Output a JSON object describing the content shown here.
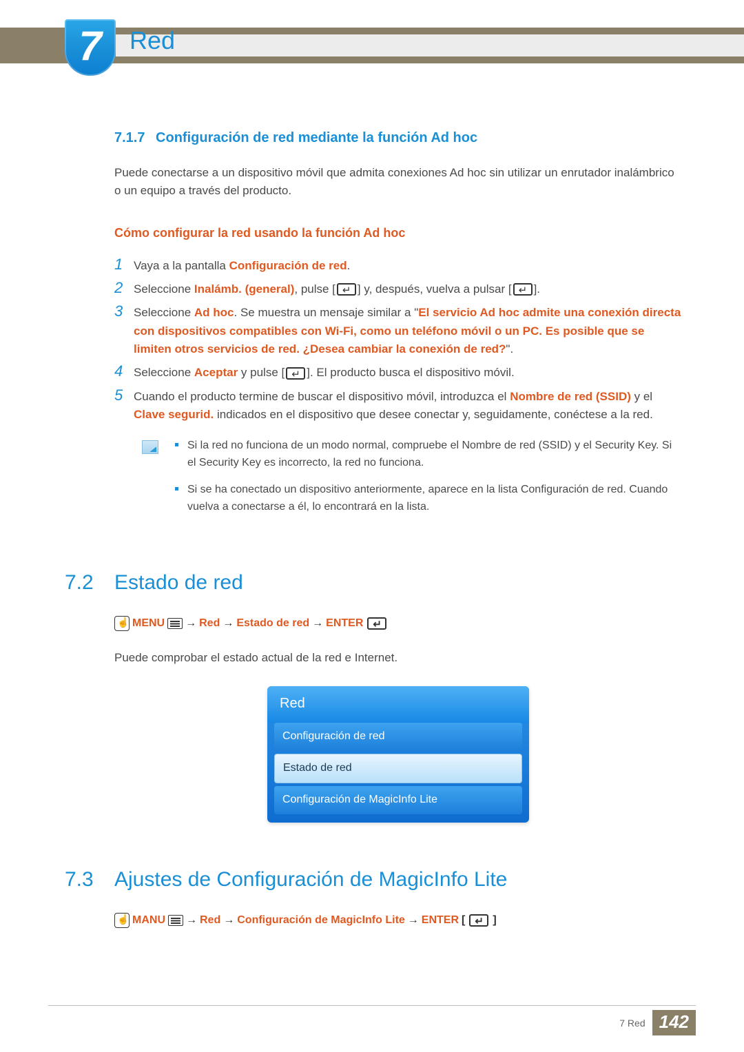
{
  "chapter": {
    "number": "7",
    "title": "Red"
  },
  "s717": {
    "num": "7.1.7",
    "title": "Configuración de red mediante la función Ad hoc",
    "intro": "Puede conectarse a un dispositivo móvil que admita conexiones Ad hoc sin utilizar un enrutador inalámbrico o un equipo a través del producto.",
    "howto_title": "Cómo configurar la red usando la función Ad hoc",
    "steps": {
      "s1_a": "Vaya a la pantalla ",
      "s1_b": "Configuración de red",
      "s1_c": ".",
      "s2_a": "Seleccione ",
      "s2_b": "Inalámb. (general)",
      "s2_c": ", pulse [",
      "s2_d": "] y, después, vuelva a pulsar [",
      "s2_e": "].",
      "s3_a": "Seleccione ",
      "s3_b": "Ad hoc",
      "s3_c": ". Se muestra un mensaje similar a \"",
      "s3_d": "El servicio Ad hoc admite una conexión directa con dispositivos compatibles con Wi-Fi, como un teléfono móvil o un PC. Es posible que se limiten otros servicios de red. ¿Desea cambiar la conexión de red?",
      "s3_e": "\".",
      "s4_a": "Seleccione ",
      "s4_b": "Aceptar",
      "s4_c": " y pulse [",
      "s4_d": "]. El producto busca el dispositivo móvil.",
      "s5_a": "Cuando el producto termine de buscar el dispositivo móvil, introduzca el ",
      "s5_b": "Nombre de red (SSID)",
      "s5_c": " y el ",
      "s5_d": "Clave segurid.",
      "s5_e": " indicados en el dispositivo que desee conectar y, seguidamente, conéctese a la red."
    },
    "notes": {
      "n1": "Si la red no funciona de un modo normal, compruebe el Nombre de red (SSID) y el Security Key. Si el Security Key es incorrecto, la red no funciona.",
      "n2": "Si se ha conectado un dispositivo anteriormente, aparece en la lista Configuración de red. Cuando vuelva a conectarse a él, lo encontrará en la lista."
    }
  },
  "s72": {
    "num": "7.2",
    "title": "Estado de red",
    "nav": {
      "menu": "MENU",
      "arrow": "→",
      "p1": "Red",
      "p2": "Estado de red",
      "enter": "ENTER"
    },
    "desc": "Puede comprobar el estado actual de la red e Internet.",
    "menu": {
      "header": "Red",
      "i1": "Configuración de red",
      "i2": "Estado de red",
      "i3": "Configuración de MagicInfo Lite"
    }
  },
  "s73": {
    "num": "7.3",
    "title": "Ajustes de Configuración de MagicInfo Lite",
    "nav": {
      "menu": "MANU",
      "arrow": "→",
      "p1": "Red",
      "p2": "Configuración de MagicInfo Lite",
      "enter": "ENTER"
    }
  },
  "footer": {
    "chapter": "7 Red",
    "page": "142"
  }
}
